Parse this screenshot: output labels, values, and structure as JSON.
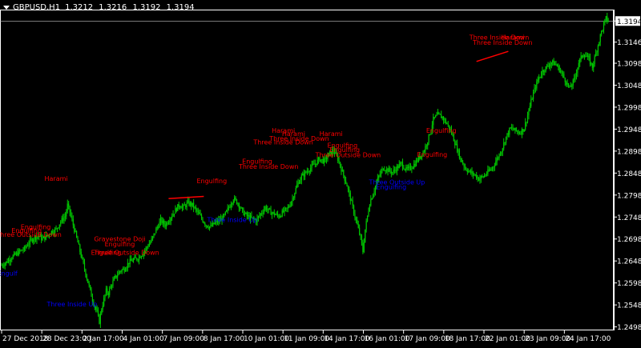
{
  "header": {
    "symbol": "GBPUSD,H1",
    "open": "1.3212",
    "high": "1.3216",
    "low": "1.3192",
    "close": "1.3194"
  },
  "current_price_label": "1.3194",
  "colors": {
    "background": "#000000",
    "candles": "#00C800",
    "bearish_pattern": "#FF0000",
    "bullish_pattern": "#0000FF",
    "axis_text": "#FFFFFF",
    "price_line": "#C0C0C0"
  },
  "chart_data": {
    "type": "candlestick",
    "y_axis_ticks": [
      "1.3194",
      "1.3146",
      "1.3098",
      "1.3048",
      "1.2998",
      "1.2948",
      "1.2898",
      "1.2848",
      "1.2798",
      "1.2748",
      "1.2698",
      "1.2648",
      "1.2598",
      "1.2548",
      "1.2498"
    ],
    "ylim": [
      1.249,
      1.322
    ],
    "x_axis_ticks": [
      "27 Dec 2018",
      "28 Dec 23:00",
      "2 Jan 17:00",
      "4 Jan 01:00",
      "7 Jan 09:00",
      "8 Jan 17:00",
      "10 Jan 01:00",
      "11 Jan 09:00",
      "14 Jan 17:00",
      "16 Jan 01:00",
      "17 Jan 09:00",
      "18 Jan 17:00",
      "22 Jan 01:00",
      "23 Jan 09:00",
      "24 Jan 17:00"
    ],
    "close_path": [
      {
        "t": 0,
        "p": 1.2638
      },
      {
        "t": 4,
        "p": 1.2645
      },
      {
        "t": 8,
        "p": 1.2655
      },
      {
        "t": 12,
        "p": 1.2662
      },
      {
        "t": 16,
        "p": 1.267
      },
      {
        "t": 20,
        "p": 1.2675
      },
      {
        "t": 24,
        "p": 1.269
      },
      {
        "t": 28,
        "p": 1.27
      },
      {
        "t": 32,
        "p": 1.2705
      },
      {
        "t": 36,
        "p": 1.2698
      },
      {
        "t": 40,
        "p": 1.2705
      },
      {
        "t": 44,
        "p": 1.2715
      },
      {
        "t": 48,
        "p": 1.272
      },
      {
        "t": 52,
        "p": 1.2738
      },
      {
        "t": 56,
        "p": 1.275
      },
      {
        "t": 58,
        "p": 1.2775
      },
      {
        "t": 60,
        "p": 1.276
      },
      {
        "t": 62,
        "p": 1.274
      },
      {
        "t": 64,
        "p": 1.272
      },
      {
        "t": 66,
        "p": 1.27
      },
      {
        "t": 68,
        "p": 1.268
      },
      {
        "t": 70,
        "p": 1.266
      },
      {
        "t": 72,
        "p": 1.264
      },
      {
        "t": 74,
        "p": 1.262
      },
      {
        "t": 76,
        "p": 1.26
      },
      {
        "t": 78,
        "p": 1.258
      },
      {
        "t": 80,
        "p": 1.256
      },
      {
        "t": 82,
        "p": 1.2545
      },
      {
        "t": 84,
        "p": 1.253
      },
      {
        "t": 86,
        "p": 1.251
      },
      {
        "t": 88,
        "p": 1.254
      },
      {
        "t": 90,
        "p": 1.256
      },
      {
        "t": 92,
        "p": 1.258
      },
      {
        "t": 94,
        "p": 1.2575
      },
      {
        "t": 96,
        "p": 1.259
      },
      {
        "t": 98,
        "p": 1.26
      },
      {
        "t": 100,
        "p": 1.261
      },
      {
        "t": 104,
        "p": 1.2625
      },
      {
        "t": 108,
        "p": 1.263
      },
      {
        "t": 112,
        "p": 1.2645
      },
      {
        "t": 116,
        "p": 1.265
      },
      {
        "t": 120,
        "p": 1.2655
      },
      {
        "t": 124,
        "p": 1.2665
      },
      {
        "t": 128,
        "p": 1.268
      },
      {
        "t": 132,
        "p": 1.2695
      },
      {
        "t": 136,
        "p": 1.272
      },
      {
        "t": 140,
        "p": 1.274
      },
      {
        "t": 144,
        "p": 1.273
      },
      {
        "t": 148,
        "p": 1.2745
      },
      {
        "t": 152,
        "p": 1.276
      },
      {
        "t": 156,
        "p": 1.2775
      },
      {
        "t": 160,
        "p": 1.277
      },
      {
        "t": 164,
        "p": 1.278
      },
      {
        "t": 168,
        "p": 1.2775
      },
      {
        "t": 172,
        "p": 1.276
      },
      {
        "t": 176,
        "p": 1.2745
      },
      {
        "t": 180,
        "p": 1.273
      },
      {
        "t": 184,
        "p": 1.2725
      },
      {
        "t": 188,
        "p": 1.2735
      },
      {
        "t": 192,
        "p": 1.274
      },
      {
        "t": 196,
        "p": 1.275
      },
      {
        "t": 200,
        "p": 1.277
      },
      {
        "t": 204,
        "p": 1.279
      },
      {
        "t": 208,
        "p": 1.278
      },
      {
        "t": 212,
        "p": 1.276
      },
      {
        "t": 216,
        "p": 1.275
      },
      {
        "t": 220,
        "p": 1.2745
      },
      {
        "t": 224,
        "p": 1.274
      },
      {
        "t": 228,
        "p": 1.2755
      },
      {
        "t": 232,
        "p": 1.277
      },
      {
        "t": 236,
        "p": 1.276
      },
      {
        "t": 240,
        "p": 1.2755
      },
      {
        "t": 244,
        "p": 1.275
      },
      {
        "t": 248,
        "p": 1.276
      },
      {
        "t": 252,
        "p": 1.2768
      },
      {
        "t": 256,
        "p": 1.279
      },
      {
        "t": 260,
        "p": 1.282
      },
      {
        "t": 264,
        "p": 1.284
      },
      {
        "t": 268,
        "p": 1.285
      },
      {
        "t": 272,
        "p": 1.286
      },
      {
        "t": 276,
        "p": 1.287
      },
      {
        "t": 280,
        "p": 1.288
      },
      {
        "t": 284,
        "p": 1.2875
      },
      {
        "t": 288,
        "p": 1.289
      },
      {
        "t": 292,
        "p": 1.29
      },
      {
        "t": 296,
        "p": 1.288
      },
      {
        "t": 300,
        "p": 1.285
      },
      {
        "t": 304,
        "p": 1.282
      },
      {
        "t": 308,
        "p": 1.278
      },
      {
        "t": 312,
        "p": 1.274
      },
      {
        "t": 316,
        "p": 1.27
      },
      {
        "t": 318,
        "p": 1.267
      },
      {
        "t": 320,
        "p": 1.272
      },
      {
        "t": 324,
        "p": 1.278
      },
      {
        "t": 328,
        "p": 1.281
      },
      {
        "t": 332,
        "p": 1.284
      },
      {
        "t": 336,
        "p": 1.286
      },
      {
        "t": 340,
        "p": 1.2855
      },
      {
        "t": 344,
        "p": 1.285
      },
      {
        "t": 348,
        "p": 1.286
      },
      {
        "t": 352,
        "p": 1.287
      },
      {
        "t": 356,
        "p": 1.2855
      },
      {
        "t": 360,
        "p": 1.286
      },
      {
        "t": 364,
        "p": 1.287
      },
      {
        "t": 368,
        "p": 1.2885
      },
      {
        "t": 372,
        "p": 1.29
      },
      {
        "t": 376,
        "p": 1.293
      },
      {
        "t": 380,
        "p": 1.297
      },
      {
        "t": 384,
        "p": 1.298
      },
      {
        "t": 388,
        "p": 1.2975
      },
      {
        "t": 392,
        "p": 1.296
      },
      {
        "t": 396,
        "p": 1.294
      },
      {
        "t": 400,
        "p": 1.291
      },
      {
        "t": 404,
        "p": 1.288
      },
      {
        "t": 408,
        "p": 1.286
      },
      {
        "t": 412,
        "p": 1.285
      },
      {
        "t": 416,
        "p": 1.2845
      },
      {
        "t": 420,
        "p": 1.2835
      },
      {
        "t": 424,
        "p": 1.284
      },
      {
        "t": 428,
        "p": 1.285
      },
      {
        "t": 432,
        "p": 1.286
      },
      {
        "t": 436,
        "p": 1.288
      },
      {
        "t": 440,
        "p": 1.29
      },
      {
        "t": 444,
        "p": 1.293
      },
      {
        "t": 448,
        "p": 1.295
      },
      {
        "t": 452,
        "p": 1.2945
      },
      {
        "t": 456,
        "p": 1.294
      },
      {
        "t": 460,
        "p": 1.295
      },
      {
        "t": 464,
        "p": 1.299
      },
      {
        "t": 468,
        "p": 1.303
      },
      {
        "t": 472,
        "p": 1.306
      },
      {
        "t": 476,
        "p": 1.308
      },
      {
        "t": 480,
        "p": 1.309
      },
      {
        "t": 484,
        "p": 1.31
      },
      {
        "t": 488,
        "p": 1.3095
      },
      {
        "t": 492,
        "p": 1.308
      },
      {
        "t": 496,
        "p": 1.306
      },
      {
        "t": 500,
        "p": 1.304
      },
      {
        "t": 504,
        "p": 1.306
      },
      {
        "t": 508,
        "p": 1.31
      },
      {
        "t": 512,
        "p": 1.312
      },
      {
        "t": 516,
        "p": 1.311
      },
      {
        "t": 520,
        "p": 1.309
      },
      {
        "t": 524,
        "p": 1.313
      },
      {
        "t": 528,
        "p": 1.317
      },
      {
        "t": 532,
        "p": 1.32
      },
      {
        "t": 534,
        "p": 1.3194
      }
    ],
    "pattern_lines": [
      {
        "t1": 147,
        "p1": 1.279,
        "t2": 178,
        "p2": 1.2795,
        "color": "#FF0000"
      },
      {
        "t1": 418,
        "p1": 1.3102,
        "t2": 446,
        "p2": 1.3125,
        "color": "#FF0000"
      }
    ],
    "annotations": [
      {
        "text": "Harami",
        "t": 48,
        "p": 1.283,
        "color": "#FF0000"
      },
      {
        "text": "Engulfing",
        "t": 30,
        "p": 1.272,
        "color": "#FF0000"
      },
      {
        "text": "Engulfing",
        "t": 22,
        "p": 1.2712,
        "color": "#FF0000"
      },
      {
        "text": "Three Outside Down",
        "t": 24,
        "p": 1.2703,
        "color": "#FF0000"
      },
      {
        "text": "Engulf",
        "t": 5,
        "p": 1.2615,
        "color": "#0000FF"
      },
      {
        "text": "Three Inside Up",
        "t": 62,
        "p": 1.2545,
        "color": "#0000FF"
      },
      {
        "text": "Gravestone Doji",
        "t": 104,
        "p": 1.2693,
        "color": "#FF0000"
      },
      {
        "text": "Engulfing",
        "t": 104,
        "p": 1.2681,
        "color": "#FF0000"
      },
      {
        "text": "Engulfing",
        "t": 92,
        "p": 1.2662,
        "color": "#FF0000"
      },
      {
        "text": "Three Outside Down",
        "t": 110,
        "p": 1.2662,
        "color": "#FF0000"
      },
      {
        "text": "Engulfing",
        "t": 185,
        "p": 1.2825,
        "color": "#FF0000"
      },
      {
        "text": "Three Inside Up",
        "t": 203,
        "p": 1.2737,
        "color": "#0000FF"
      },
      {
        "text": "Engulfing",
        "t": 225,
        "p": 1.287,
        "color": "#FF0000"
      },
      {
        "text": "Three Inside Down",
        "t": 235,
        "p": 1.2858,
        "color": "#FF0000"
      },
      {
        "text": "Harami",
        "t": 248,
        "p": 1.294,
        "color": "#FF0000"
      },
      {
        "text": "Harami",
        "t": 257,
        "p": 1.2932,
        "color": "#FF0000"
      },
      {
        "text": "Three Inside Down",
        "t": 262,
        "p": 1.2921,
        "color": "#FF0000"
      },
      {
        "text": "Three Inside Down",
        "t": 248,
        "p": 1.2913,
        "color": "#FF0000"
      },
      {
        "text": "Harami",
        "t": 290,
        "p": 1.2932,
        "color": "#FF0000"
      },
      {
        "text": "Engulfing",
        "t": 300,
        "p": 1.2906,
        "color": "#FF0000"
      },
      {
        "text": "Engulfing",
        "t": 302,
        "p": 1.2896,
        "color": "#FF0000"
      },
      {
        "text": "Three Outside Down",
        "t": 305,
        "p": 1.2884,
        "color": "#FF0000"
      },
      {
        "text": "Three Outside Up",
        "t": 348,
        "p": 1.2822,
        "color": "#0000FF"
      },
      {
        "text": "Engulfing",
        "t": 343,
        "p": 1.2811,
        "color": "#0000FF"
      },
      {
        "text": "Engulfing",
        "t": 387,
        "p": 1.294,
        "color": "#FF0000"
      },
      {
        "text": "Engulfing",
        "t": 379,
        "p": 1.2885,
        "color": "#FF0000"
      },
      {
        "text": "Three Inside Down",
        "t": 438,
        "p": 1.3152,
        "color": "#FF0000"
      },
      {
        "text": "Harami",
        "t": 450,
        "p": 1.3152,
        "color": "#FF0000"
      },
      {
        "text": "Three Inside Down",
        "t": 441,
        "p": 1.314,
        "color": "#FF0000"
      }
    ]
  }
}
